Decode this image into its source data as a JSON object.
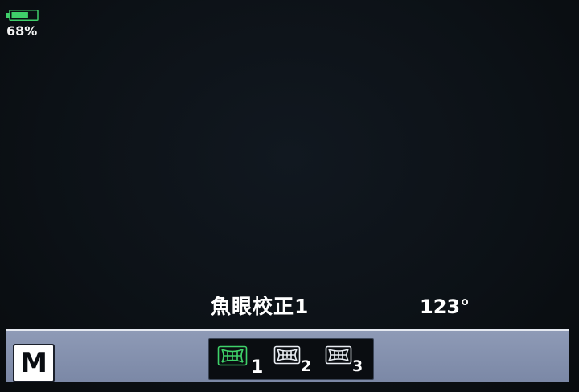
{
  "battery": {
    "percent_label": "68%",
    "level": 0.68,
    "color": "#3fcf6a"
  },
  "info": {
    "mode_name": "魚眼校正1",
    "angle": "123°"
  },
  "bottom_bar": {
    "mode_badge": "M",
    "options": [
      {
        "number": "1",
        "selected": true
      },
      {
        "number": "2",
        "selected": false
      },
      {
        "number": "3",
        "selected": false
      }
    ]
  },
  "colors": {
    "selected": "#3fd26a",
    "unselected": "#e8ecf2",
    "bar": "#8391ad"
  },
  "icons": {
    "battery": "battery-icon",
    "option": "fisheye-correction-icon"
  }
}
